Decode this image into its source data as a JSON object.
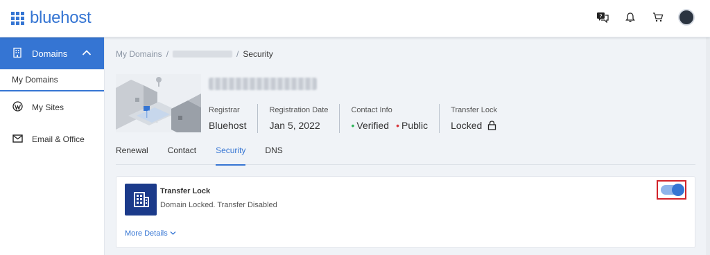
{
  "brand": {
    "name": "bluehost",
    "accent": "#3575d3"
  },
  "header": {
    "icons": [
      "help-chat-icon",
      "bell-icon",
      "cart-icon",
      "avatar"
    ]
  },
  "sidebar": {
    "items": [
      {
        "label": "Domains",
        "icon": "building-icon",
        "active": true
      },
      {
        "label": "My Domains",
        "sub": true
      },
      {
        "label": "My Sites",
        "icon": "wordpress-icon"
      },
      {
        "label": "Email & Office",
        "icon": "envelope-icon"
      }
    ]
  },
  "breadcrumb": {
    "root": "My Domains",
    "sep1": "/",
    "sep2": "/",
    "current": "Security"
  },
  "domain": {
    "facts": [
      {
        "label": "Registrar",
        "value": "Bluehost"
      },
      {
        "label": "Registration Date",
        "value": "Jan 5, 2022"
      },
      {
        "label": "Contact Info",
        "verified": "Verified",
        "public": "Public"
      },
      {
        "label": "Transfer Lock",
        "value": "Locked"
      }
    ]
  },
  "tabs": [
    "Renewal",
    "Contact",
    "Security",
    "DNS"
  ],
  "active_tab": "Security",
  "card": {
    "title": "Transfer Lock",
    "description": "Domain Locked. Transfer Disabled",
    "more": "More Details",
    "toggle_on": true
  }
}
